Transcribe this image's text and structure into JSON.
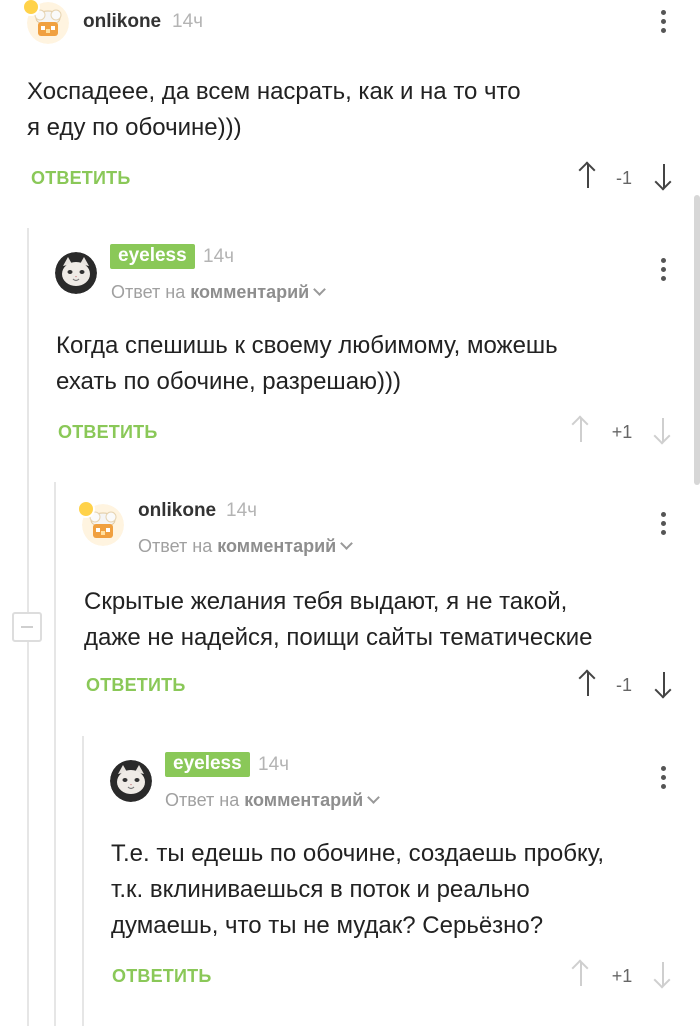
{
  "reply_label": "ОТВЕТИТЬ",
  "reply_to_prefix": "Ответ на",
  "reply_to_target": "комментарий",
  "comments": [
    {
      "author": "onlikone",
      "time": "14ч",
      "text": "Хоспадеее, да всем насрать, как и на то что\nя еду по обочине)))",
      "score": "-1"
    },
    {
      "author": "eyeless",
      "time": "14ч",
      "text": "Когда спешишь к своему любимому, можешь\nехать по обочине, разрешаю)))",
      "score": "+1"
    },
    {
      "author": "onlikone",
      "time": "14ч",
      "text": "Скрытые желания тебя выдают, я не такой,\nдаже не надейся, поищи сайты тематические",
      "score": "-1"
    },
    {
      "author": "eyeless",
      "time": "14ч",
      "text": "Т.е. ты едешь по обочине, создаешь пробку,\nт.к. вклиниваешься в поток и реально\nдумаешь, что ты не мудак? Серьёзно?",
      "score": "+1"
    }
  ]
}
